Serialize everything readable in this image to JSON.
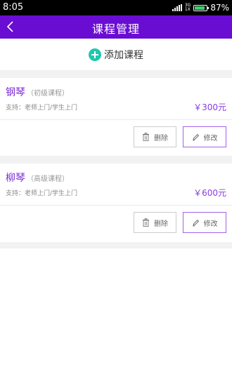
{
  "status_bar": {
    "time": "8:05",
    "network_top": "3G",
    "network_bottom": "1X",
    "battery_percent": "87%",
    "battery_level": 0.87
  },
  "nav": {
    "title": "课程管理",
    "back_icon": "chevron-left-icon",
    "background_color": "#6a0dd3"
  },
  "add_course": {
    "icon": "plus-circle-icon",
    "label": "添加课程",
    "icon_color": "#1ec8b0"
  },
  "courses": [
    {
      "name": "钢琴",
      "level": "（初级课程）",
      "support": "支持：老师上门/学生上门",
      "price": "￥300元",
      "delete_label": "删除",
      "edit_label": "修改"
    },
    {
      "name": "柳琴",
      "level": "（高级课程）",
      "support": "支持：老师上门/学生上门",
      "price": "￥600元",
      "delete_label": "删除",
      "edit_label": "修改"
    }
  ],
  "colors": {
    "accent": "#7a2bd4",
    "price": "#8a3be0",
    "edit_border": "#a262e8"
  }
}
